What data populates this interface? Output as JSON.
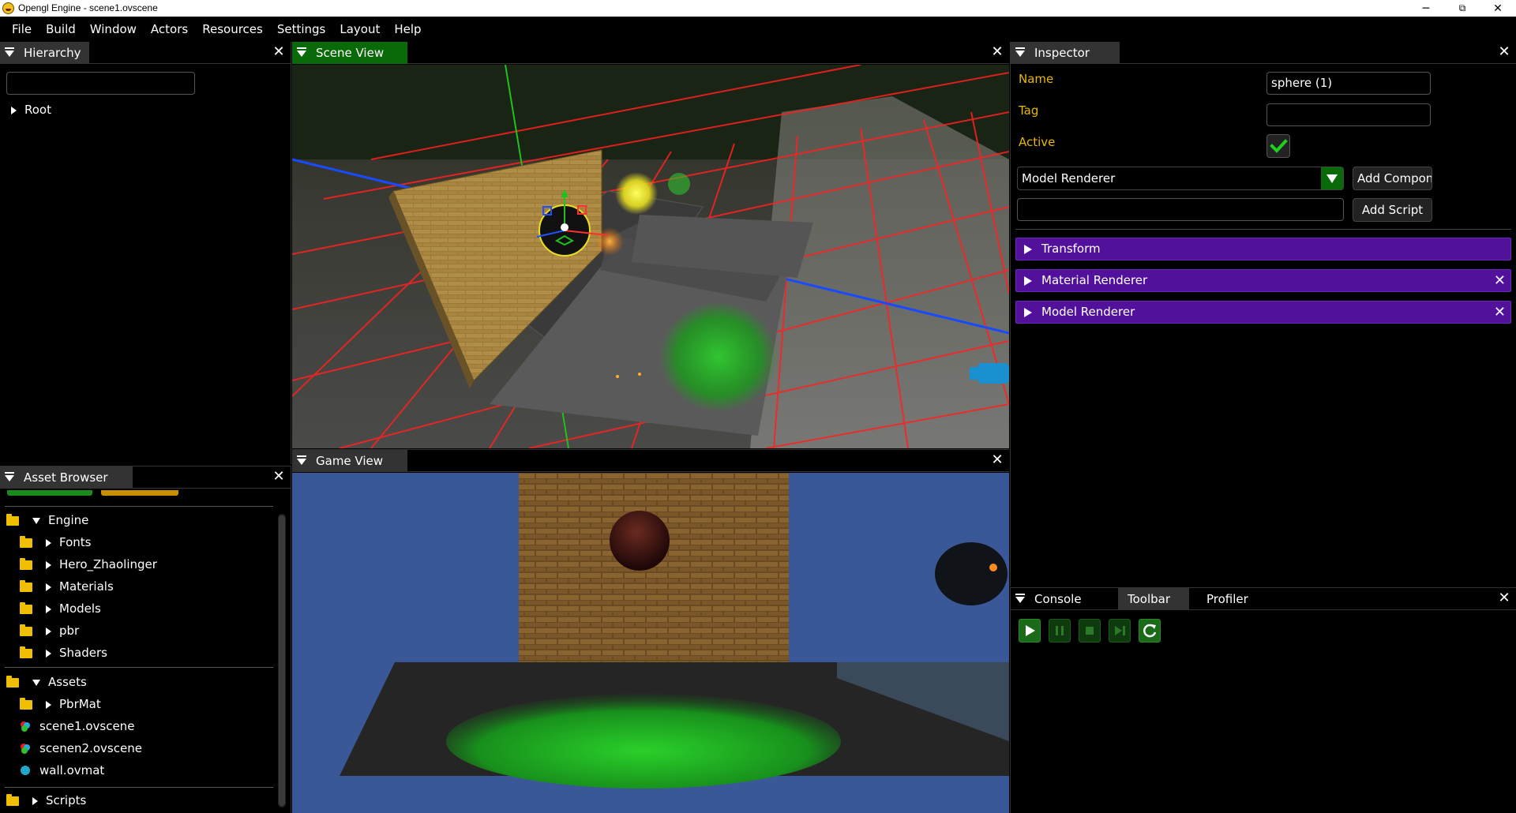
{
  "window": {
    "title": "Opengl Engine - scene1.ovscene",
    "minimize": "─",
    "maximize": "⧉",
    "close": "✕"
  },
  "menu": [
    "File",
    "Build",
    "Window",
    "Actors",
    "Resources",
    "Settings",
    "Layout",
    "Help"
  ],
  "hierarchy": {
    "tab": "Hierarchy",
    "search_value": "",
    "root_label": "Root"
  },
  "scene_view": {
    "tab": "Scene View"
  },
  "game_view": {
    "tab": "Game View"
  },
  "asset_browser": {
    "tab": "Asset Browser",
    "engine_label": "Engine",
    "engine_children": [
      "Fonts",
      "Hero_Zhaolinger",
      "Materials",
      "Models",
      "pbr",
      "Shaders"
    ],
    "assets_label": "Assets",
    "assets_folder": "PbrMat",
    "files": [
      {
        "name": "scene1.ovscene",
        "icon": "scene-file-icon"
      },
      {
        "name": "scenen2.ovscene",
        "icon": "scene-file-icon"
      },
      {
        "name": "wall.ovmat",
        "icon": "material-file-icon"
      }
    ],
    "scripts_label": "Scripts"
  },
  "inspector": {
    "tab": "Inspector",
    "name_label": "Name",
    "name_value": "sphere (1)",
    "tag_label": "Tag",
    "tag_value": "",
    "active_label": "Active",
    "active_checked": true,
    "component_select": "Model Renderer",
    "add_component_label": "Add Component",
    "script_input": "",
    "add_script_label": "Add Script",
    "components": [
      {
        "label": "Transform",
        "removable": false
      },
      {
        "label": "Material Renderer",
        "removable": true
      },
      {
        "label": "Model Renderer",
        "removable": true
      }
    ]
  },
  "bottom_tabs": {
    "console": "Console",
    "toolbar": "Toolbar",
    "profiler": "Profiler"
  },
  "colors": {
    "label_gold": "#e8b800",
    "component_purple": "#52119a",
    "scene_tab_green": "#0a6a0a"
  }
}
